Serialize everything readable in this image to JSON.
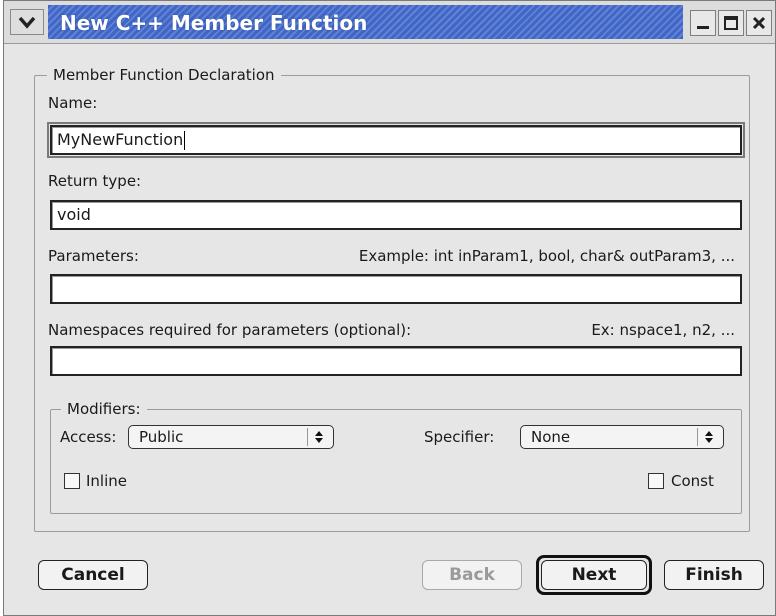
{
  "window": {
    "title": "New C++ Member Function"
  },
  "declaration": {
    "legend": "Member Function Declaration",
    "name_label": "Name:",
    "name_value": "MyNewFunction",
    "return_type_label": "Return type:",
    "return_type_value": "void",
    "parameters_label": "Parameters:",
    "parameters_example": "Example: int inParam1, bool, char& outParam3, ...",
    "parameters_value": "",
    "namespaces_label": "Namespaces required for parameters (optional):",
    "namespaces_example": "Ex: nspace1, n2, ...",
    "namespaces_value": ""
  },
  "modifiers": {
    "legend": "Modifiers:",
    "access_label": "Access:",
    "access_value": "Public",
    "specifier_label": "Specifier:",
    "specifier_value": "None",
    "inline_label": "Inline",
    "inline_checked": false,
    "const_label": "Const",
    "const_checked": false
  },
  "buttons": {
    "cancel": "Cancel",
    "back": "Back",
    "next": "Next",
    "finish": "Finish"
  },
  "icons": {
    "window_menu": "chevron-down-icon",
    "minimize": "minimize-icon",
    "maximize": "maximize-icon",
    "close": "close-icon",
    "popup": "updown-arrows-icon"
  },
  "colors": {
    "titlebar_accent": "#3f66c8",
    "window_bg": "#e6e6e6"
  }
}
